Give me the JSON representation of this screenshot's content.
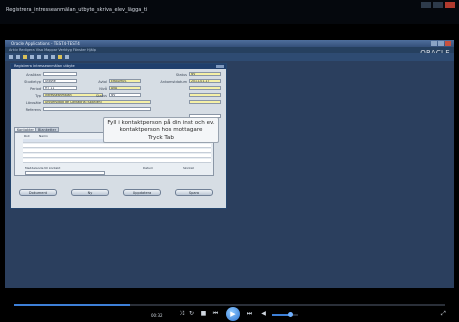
{
  "player": {
    "title": "Registrera_intresseanmälan_utbyte_skriva_elev_lägga_ti",
    "time": "00:32",
    "progress_fraction": 0.27,
    "volume_fraction": 0.7,
    "controls": {
      "shuffle_icon": "shuffle-icon",
      "repeat_icon": "repeat-icon",
      "stop_icon": "stop-icon",
      "prev_icon": "previous-icon",
      "play_icon": "play-icon",
      "next_icon": "next-icon",
      "mute_icon": "volume-icon",
      "fullscreen_icon": "fullscreen-icon"
    }
  },
  "app": {
    "window_title": "Oracle Applications - TEST4-TEST4",
    "menu": "Arkiv  Redigera  Visa  Mappar  Verktyg  Fönster  Hjälp",
    "brand": "ORACLE"
  },
  "form": {
    "title": "Registrera intresseanmälan utbyte",
    "fields_left": [
      {
        "label": "Ansökan",
        "value": ""
      },
      {
        "label": "Studietyp",
        "value": "Utbyte"
      },
      {
        "label": "Period",
        "value": "HT 11"
      },
      {
        "label": "Typ",
        "value": "Intresseanmälan"
      },
      {
        "label": "Lärosäte",
        "value": "Universidad de Cantabria (Spanien)"
      },
      {
        "label": "Referens",
        "value": ""
      }
    ],
    "fields_mid": [
      {
        "label": "Avtal",
        "value": "ERASMUS"
      },
      {
        "label": "Nivå",
        "value": "AVA"
      },
      {
        "label": "Status",
        "value": "Ny"
      }
    ],
    "fields_right": [
      {
        "label": "Status",
        "value": "Ny"
      },
      {
        "label": "Ankomstdatum",
        "value": "2011-01-17"
      }
    ],
    "tabs": [
      "Kontakter",
      "Blanketter"
    ],
    "grid_headers": [
      "Roll",
      "Namn",
      "Telefon",
      "E-post"
    ],
    "summary": {
      "label1": "Meddelande till kontakt",
      "label2": "Datum",
      "label3": "Skickat"
    },
    "buttons": [
      "Dokument",
      "Ny",
      "Uppdatera",
      "Spara"
    ]
  },
  "tooltip": {
    "line1": "Fyll i kontaktperson på din inst och ev.",
    "line2": "kontaktperson hos mottagare",
    "line3": "Tryck Tab"
  },
  "colors": {
    "player_accent": "#3d7fd6",
    "app_background": "#2b3f5e",
    "required_field": "#f5f0a6"
  }
}
